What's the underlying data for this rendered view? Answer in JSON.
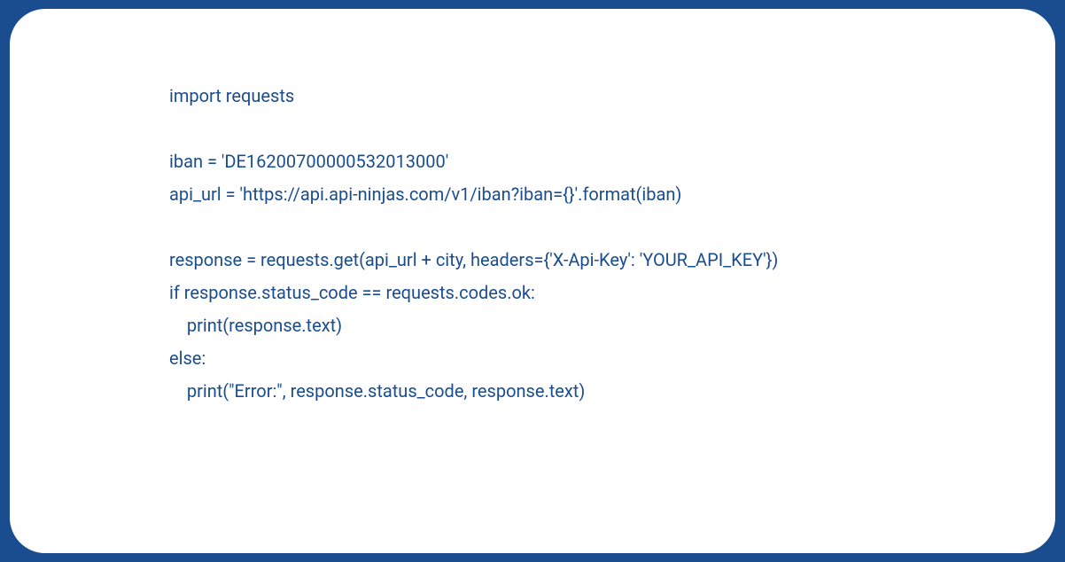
{
  "code": {
    "lines": [
      "import requests",
      "",
      "iban = 'DE16200700000532013000'",
      "api_url = 'https://api.api-ninjas.com/v1/iban?iban={}'.format(iban)",
      "",
      "response = requests.get(api_url + city, headers={'X-Api-Key': 'YOUR_API_KEY'})",
      "if response.status_code == requests.codes.ok:",
      "    print(response.text)",
      "else:",
      "    print(\"Error:\", response.status_code, response.text)"
    ]
  }
}
